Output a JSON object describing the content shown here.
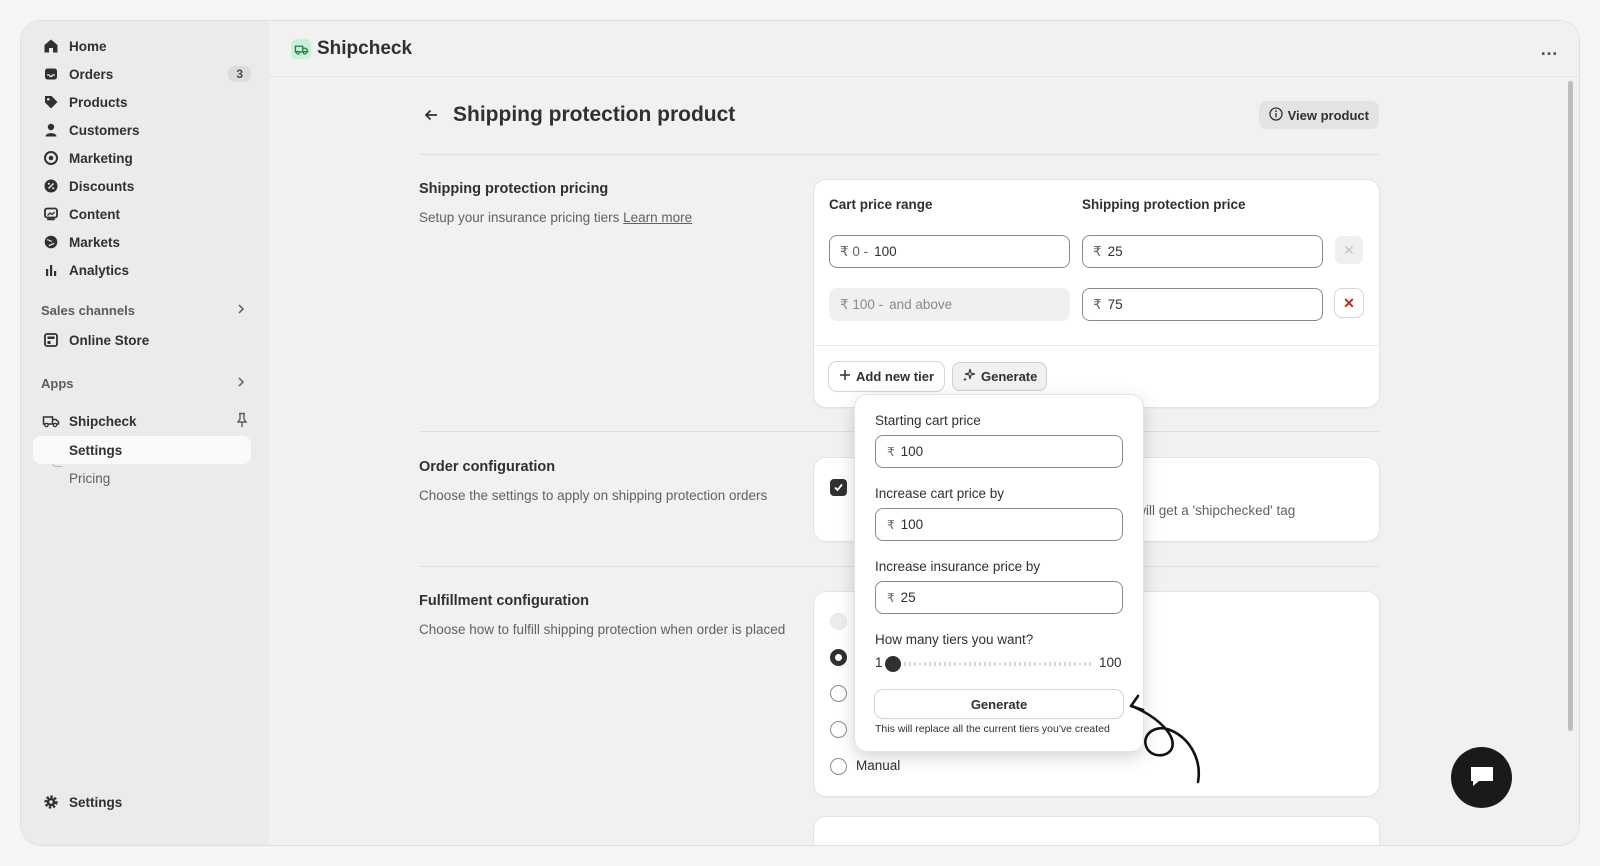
{
  "sidebar": {
    "nav": [
      {
        "label": "Home",
        "icon": "home-icon"
      },
      {
        "label": "Orders",
        "icon": "inbox-icon",
        "badge": "3"
      },
      {
        "label": "Products",
        "icon": "tag-icon"
      },
      {
        "label": "Customers",
        "icon": "person-icon"
      },
      {
        "label": "Marketing",
        "icon": "target-icon"
      },
      {
        "label": "Discounts",
        "icon": "discount-icon"
      },
      {
        "label": "Content",
        "icon": "image-icon"
      },
      {
        "label": "Markets",
        "icon": "globe-icon"
      },
      {
        "label": "Analytics",
        "icon": "bar-chart-icon"
      }
    ],
    "sales_channels": {
      "heading": "Sales channels",
      "items": [
        {
          "label": "Online Store",
          "icon": "store-icon"
        }
      ]
    },
    "apps": {
      "heading": "Apps",
      "app": {
        "label": "Shipcheck",
        "icon": "truck-icon"
      },
      "sub_items": [
        {
          "label": "Settings"
        },
        {
          "label": "Pricing"
        }
      ]
    },
    "footer": {
      "label": "Settings",
      "icon": "gear-icon"
    }
  },
  "topbar": {
    "app_title": "Shipcheck",
    "more": "…"
  },
  "page": {
    "title": "Shipping protection product",
    "view_button": "View product"
  },
  "pricing": {
    "title": "Shipping protection pricing",
    "desc": "Setup your insurance pricing tiers",
    "learn_more": "Learn more",
    "col_range": "Cart price range",
    "col_price": "Shipping protection price",
    "currency": "₹",
    "tiers": [
      {
        "range_prefix": "₹ 0 -",
        "range_value": "100",
        "price": "25"
      },
      {
        "range_prefix": "₹ 100 -",
        "range_value": "and above",
        "price": "75"
      }
    ],
    "add_tier": "Add new tier",
    "generate": "Generate"
  },
  "order_config": {
    "title": "Order configuration",
    "desc": "Choose the settings to apply on shipping protection orders",
    "visible_text": "n will get a 'shipchecked' tag"
  },
  "fulfillment": {
    "title": "Fulfillment configuration",
    "desc": "Choose how to fulfill shipping protection when order is placed",
    "manual_label": "Manual"
  },
  "popover": {
    "starting_label": "Starting cart price",
    "starting_value": "100",
    "increase_cart_label": "Increase cart price by",
    "increase_cart_value": "100",
    "increase_ins_label": "Increase insurance price by",
    "increase_ins_value": "25",
    "tiers_label": "How many tiers you want?",
    "slider_min": "1",
    "slider_max": "100",
    "slider_value": 3,
    "generate": "Generate",
    "note": "This will replace all the current tiers you've created"
  }
}
